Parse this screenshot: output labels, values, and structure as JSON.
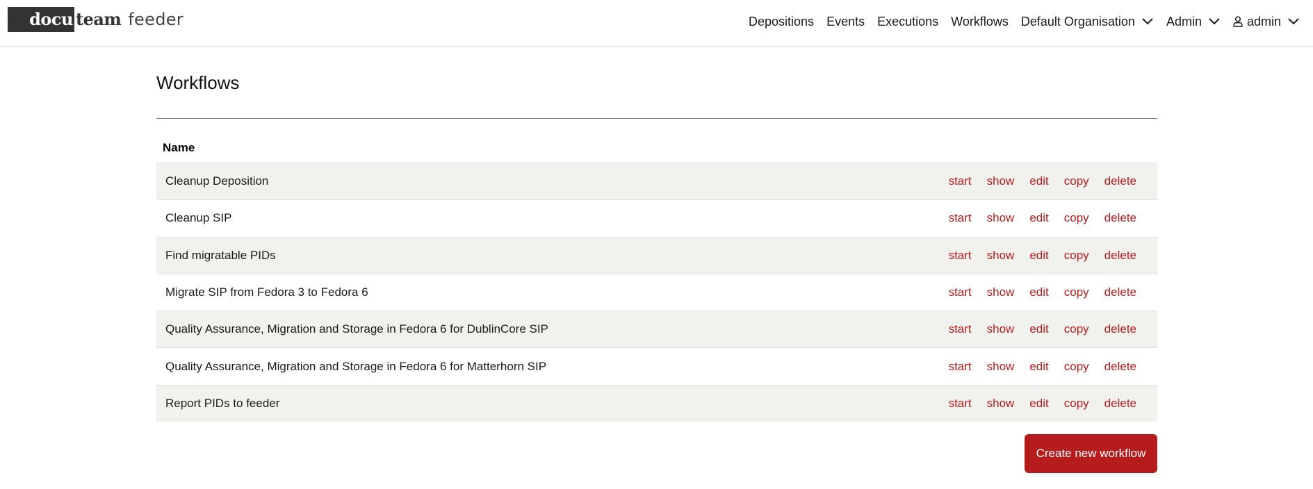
{
  "header": {
    "logo": {
      "part1": "docu",
      "part2": "team",
      "part3": "feeder"
    },
    "nav": [
      {
        "label": "Depositions",
        "dropdown": false
      },
      {
        "label": "Events",
        "dropdown": false
      },
      {
        "label": "Executions",
        "dropdown": false
      },
      {
        "label": "Workflows",
        "dropdown": false
      },
      {
        "label": "Default Organisation",
        "dropdown": true
      },
      {
        "label": "Admin",
        "dropdown": true
      }
    ],
    "user": {
      "label": "admin",
      "icon": "user-icon",
      "dropdown": true
    }
  },
  "main": {
    "title": "Workflows",
    "table": {
      "columns": [
        "Name"
      ],
      "actions": [
        "start",
        "show",
        "edit",
        "copy",
        "delete"
      ],
      "rows": [
        {
          "name": "Cleanup Deposition"
        },
        {
          "name": "Cleanup SIP"
        },
        {
          "name": "Find migratable PIDs"
        },
        {
          "name": "Migrate SIP from Fedora 3 to Fedora 6"
        },
        {
          "name": "Quality Assurance, Migration and Storage in Fedora 6 for DublinCore SIP"
        },
        {
          "name": "Quality Assurance, Migration and Storage in Fedora 6 for Matterhorn SIP"
        },
        {
          "name": "Report PIDs to feeder"
        }
      ]
    },
    "create_button": "Create new workflow"
  },
  "colors": {
    "accent": "#b71c1c",
    "logo_box": "#333333",
    "row_stripe": "#f1f1ee"
  }
}
